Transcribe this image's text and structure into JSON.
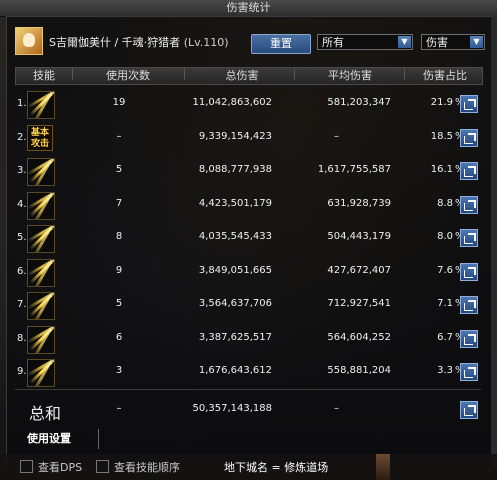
{
  "window": {
    "title": "伤害统计"
  },
  "header": {
    "char_name": "S吉爾伽美什 / 千魂·狩猎者",
    "char_level": "(Lv.110)",
    "reset_label": "重置",
    "filter_select": "所有",
    "metric_select": "伤害"
  },
  "table": {
    "columns": [
      "技能",
      "使用次数",
      "总伤害",
      "平均伤害",
      "伤害占比"
    ],
    "rows": [
      {
        "index": "1.",
        "skill_icon": "golden-slash-skill-icon",
        "uses": "19",
        "total": "11,042,863,602",
        "avg": "581,203,347",
        "pct": "21.9",
        "pct_unit": "%"
      },
      {
        "index": "2.",
        "skill_icon": "basic-attack-skill-icon",
        "skill_text": "基本攻击",
        "uses": "–",
        "total": "9,339,154,423",
        "avg": "–",
        "pct": "18.5",
        "pct_unit": "%"
      },
      {
        "index": "3.",
        "skill_icon": "lightning-strike-skill-icon",
        "uses": "5",
        "total": "8,088,777,938",
        "avg": "1,617,755,587",
        "pct": "16.1",
        "pct_unit": "%"
      },
      {
        "index": "4.",
        "skill_icon": "arrow-barrage-skill-icon",
        "uses": "7",
        "total": "4,423,501,179",
        "avg": "631,928,739",
        "pct": "8.8",
        "pct_unit": "%"
      },
      {
        "index": "5.",
        "skill_icon": "triple-shot-skill-icon",
        "uses": "8",
        "total": "4,035,545,433",
        "avg": "504,443,179",
        "pct": "8.0",
        "pct_unit": "%"
      },
      {
        "index": "6.",
        "skill_icon": "piercing-ray-skill-icon",
        "uses": "9",
        "total": "3,849,051,665",
        "avg": "427,672,407",
        "pct": "7.6",
        "pct_unit": "%"
      },
      {
        "index": "7.",
        "skill_icon": "dash-arrow-skill-icon",
        "uses": "5",
        "total": "3,564,637,706",
        "avg": "712,927,541",
        "pct": "7.1",
        "pct_unit": "%"
      },
      {
        "index": "8.",
        "skill_icon": "spread-shot-skill-icon",
        "uses": "6",
        "total": "3,387,625,517",
        "avg": "564,604,252",
        "pct": "6.7",
        "pct_unit": "%"
      },
      {
        "index": "9.",
        "skill_icon": "spiral-skill-icon",
        "uses": "3",
        "total": "1,676,643,612",
        "avg": "558,881,204",
        "pct": "3.3",
        "pct_unit": "%"
      }
    ],
    "summary": {
      "label": "总和",
      "uses": "–",
      "total": "50,357,143,188",
      "avg": "–"
    }
  },
  "footer": {
    "settings_tab": "使用设置",
    "show_dps": "查看DPS",
    "show_skill_order": "查看技能顺序",
    "dungeon_label": "地下城名 = 修炼道场"
  }
}
